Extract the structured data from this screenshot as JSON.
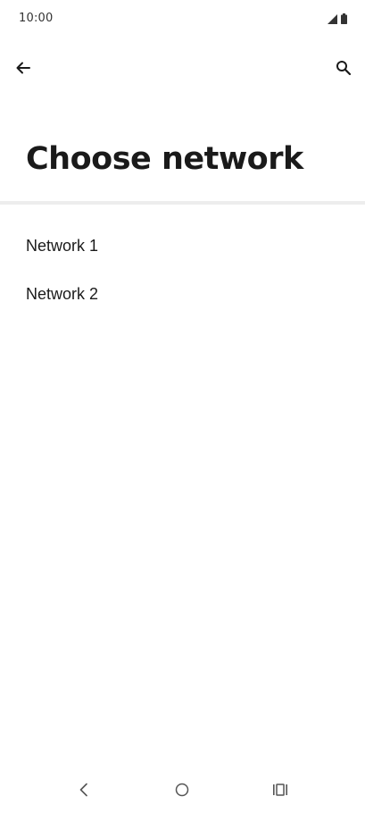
{
  "status_bar": {
    "time": "10:00",
    "icons": [
      "signal-icon",
      "battery-icon"
    ]
  },
  "app_bar": {
    "back_icon": "arrow-left-icon",
    "search_icon": "search-icon"
  },
  "page": {
    "title": "Choose network"
  },
  "networks": [
    {
      "label": "Network 1"
    },
    {
      "label": "Network 2"
    }
  ],
  "nav_bar": {
    "icons": [
      "nav-back-icon",
      "nav-home-icon",
      "nav-recents-icon"
    ]
  },
  "colors": {
    "background": "#ffffff",
    "text": "#1a1a1a",
    "divider": "#ededed"
  }
}
